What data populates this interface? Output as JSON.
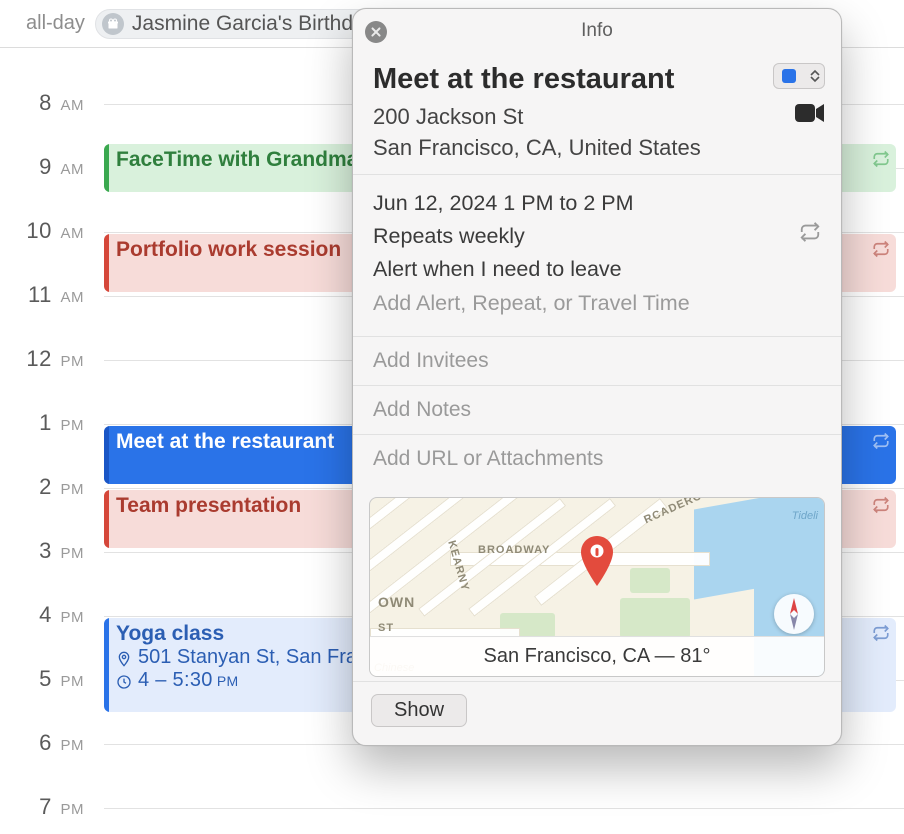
{
  "allday_label": "all-day",
  "birthday": "Jasmine Garcia's Birthday",
  "hours": [
    {
      "h": "8",
      "mer": "AM"
    },
    {
      "h": "9",
      "mer": "AM"
    },
    {
      "h": "10",
      "mer": "AM"
    },
    {
      "h": "11",
      "mer": "AM"
    },
    {
      "h": "12",
      "mer": "PM"
    },
    {
      "h": "1",
      "mer": "PM"
    },
    {
      "h": "2",
      "mer": "PM"
    },
    {
      "h": "3",
      "mer": "PM"
    },
    {
      "h": "4",
      "mer": "PM"
    },
    {
      "h": "5",
      "mer": "PM"
    },
    {
      "h": "6",
      "mer": "PM"
    },
    {
      "h": "7",
      "mer": "PM"
    }
  ],
  "events": {
    "facetime": "FaceTime with Grandma",
    "portfolio": "Portfolio work session",
    "meet": "Meet at the restaurant",
    "team": "Team presentation",
    "yoga_title": "Yoga class",
    "yoga_loc": "501 Stanyan St, San Francisco",
    "yoga_time": "4 – 5:30 PM"
  },
  "popover": {
    "header": "Info",
    "title": "Meet at the restaurant",
    "addr_line1": "200 Jackson St",
    "addr_line2": "San Francisco, CA, United States",
    "datetime": "Jun 12, 2024  1 PM to 2 PM",
    "repeat": "Repeats weekly",
    "alert": "Alert when I need to leave",
    "add_alert": "Add Alert, Repeat, or Travel Time",
    "add_invitees": "Add Invitees",
    "add_notes": "Add Notes",
    "add_url": "Add URL or Attachments",
    "map_caption": "San Francisco, CA — 81°",
    "map_labels": {
      "broadway": "BROADWAY",
      "kearny": "KEARNY",
      "rcadero": "RCADERO",
      "tideli": "Tideli",
      "own": "OWN",
      "st": "ST",
      "chinese": "Chinese"
    },
    "show": "Show"
  }
}
